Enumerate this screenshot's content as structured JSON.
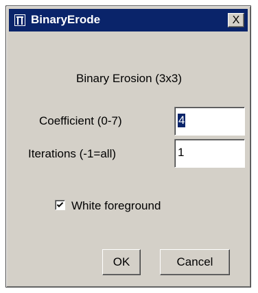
{
  "window": {
    "title": "BinaryErode",
    "close_label": "X"
  },
  "dialog": {
    "heading": "Binary Erosion (3x3)",
    "fields": [
      {
        "label": "Coefficient (0-7)",
        "value": "4",
        "selected": true
      },
      {
        "label": "Iterations (-1=all)",
        "value": "1",
        "selected": false
      }
    ],
    "checkbox": {
      "label": "White foreground",
      "checked": true
    },
    "buttons": {
      "ok": "OK",
      "cancel": "Cancel"
    }
  },
  "colors": {
    "titlebar": "#0a246a",
    "face": "#d4d0c8",
    "selection": "#0a246a"
  },
  "icons": {
    "app": "imagej-icon",
    "close": "close-icon",
    "check": "checkmark-icon"
  }
}
